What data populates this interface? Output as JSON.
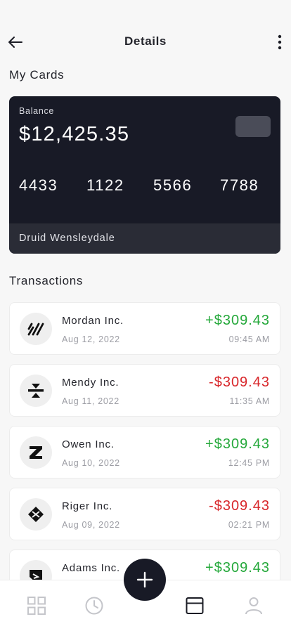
{
  "header": {
    "title": "Details",
    "back_icon": "arrow-left-icon",
    "more_icon": "vertical-dots-icon"
  },
  "my_cards": {
    "title": "My Cards",
    "card": {
      "balance_label": "Balance",
      "balance": "$12,425.35",
      "number_groups": [
        "4433",
        "1122",
        "5566",
        "7788"
      ],
      "holder": "Druid Wensleydale"
    }
  },
  "transactions": {
    "title": "Transactions",
    "items": [
      {
        "name": "Mordan Inc.",
        "date": "Aug 12, 2022",
        "amount": "+$309.43",
        "time": "09:45 AM",
        "direction": "credit"
      },
      {
        "name": "Mendy Inc.",
        "date": "Aug 11, 2022",
        "amount": "-$309.43",
        "time": "11:35 AM",
        "direction": "debit"
      },
      {
        "name": "Owen Inc.",
        "date": "Aug 10, 2022",
        "amount": "+$309.43",
        "time": "12:45 PM",
        "direction": "credit"
      },
      {
        "name": "Riger Inc.",
        "date": "Aug 09, 2022",
        "amount": "-$309.43",
        "time": "02:21 PM",
        "direction": "debit"
      },
      {
        "name": "Adams Inc.",
        "date": "",
        "amount": "+$309.43",
        "time": "",
        "direction": "credit"
      }
    ]
  },
  "bottom_nav": {
    "items": [
      {
        "icon": "grid-icon",
        "active": false
      },
      {
        "icon": "clock-icon",
        "active": false
      },
      {
        "icon": "card-icon",
        "active": true
      },
      {
        "icon": "user-icon",
        "active": false
      }
    ],
    "fab_icon": "plus-icon"
  },
  "colors": {
    "card": "#181a26",
    "positive": "#24a83a",
    "negative": "#d8262a",
    "background": "#f7f7f7"
  }
}
